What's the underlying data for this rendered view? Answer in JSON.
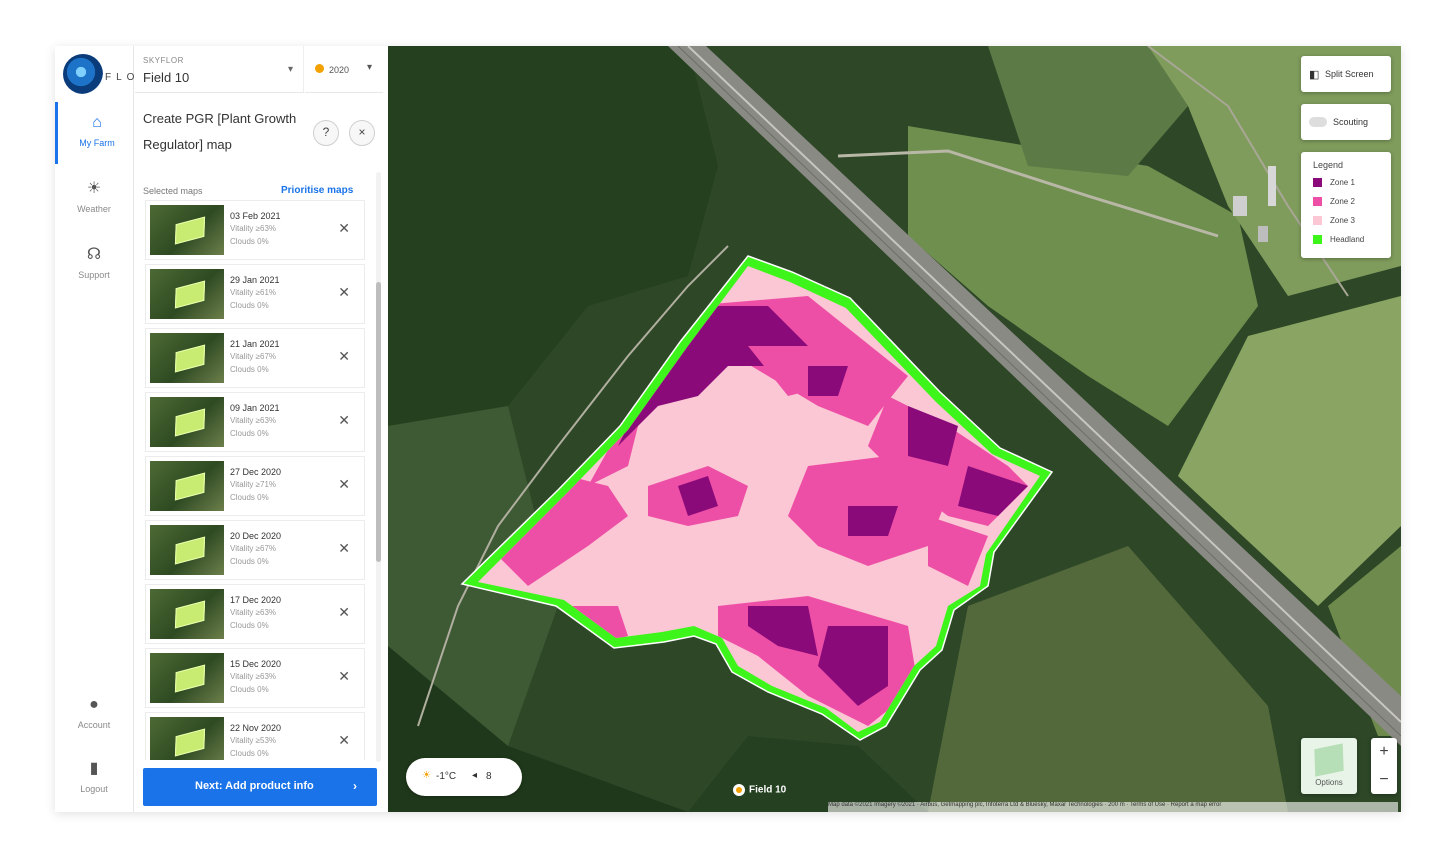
{
  "brand": {
    "logo_text": "FLO"
  },
  "rail": {
    "items": [
      {
        "label": "My Farm",
        "icon": "home-icon",
        "glyph": "⌂",
        "active": true
      },
      {
        "label": "Weather",
        "icon": "sun-icon",
        "glyph": "☀",
        "active": false
      },
      {
        "label": "Support",
        "icon": "headset-icon",
        "glyph": "☊",
        "active": false
      }
    ],
    "bottom": [
      {
        "label": "Account",
        "icon": "account-icon",
        "glyph": "●"
      },
      {
        "label": "Logout",
        "icon": "logout-icon",
        "glyph": "▮"
      }
    ]
  },
  "header": {
    "farm_caption": "SKYFLOR",
    "field_name": "Field 10",
    "season": "2020",
    "collapse_glyph": "«"
  },
  "panel": {
    "title": "Create PGR [Plant Growth Regulator] map",
    "help_glyph": "?",
    "close_glyph": "×",
    "selected_label": "Selected maps",
    "prioritise_label": "Prioritise maps",
    "next_label": "Next: Add product info",
    "next_arrow": "›"
  },
  "maps": [
    {
      "date": "03 Feb 2021",
      "vitality": "Vitality ≥63%",
      "clouds": "Clouds 0%"
    },
    {
      "date": "29 Jan 2021",
      "vitality": "Vitality ≥61%",
      "clouds": "Clouds 0%"
    },
    {
      "date": "21 Jan 2021",
      "vitality": "Vitality ≥67%",
      "clouds": "Clouds 0%"
    },
    {
      "date": "09 Jan 2021",
      "vitality": "Vitality ≥63%",
      "clouds": "Clouds 0%"
    },
    {
      "date": "27 Dec 2020",
      "vitality": "Vitality ≥71%",
      "clouds": "Clouds 0%"
    },
    {
      "date": "20 Dec 2020",
      "vitality": "Vitality ≥67%",
      "clouds": "Clouds 0%"
    },
    {
      "date": "17 Dec 2020",
      "vitality": "Vitality ≥63%",
      "clouds": "Clouds 0%"
    },
    {
      "date": "15 Dec 2020",
      "vitality": "Vitality ≥63%",
      "clouds": "Clouds 0%"
    },
    {
      "date": "22 Nov 2020",
      "vitality": "Vitality ≥53%",
      "clouds": "Clouds 0%"
    }
  ],
  "map": {
    "split_label": "Split Screen",
    "scouting_label": "Scouting",
    "legend_title": "Legend",
    "legend": [
      {
        "label": "Zone 1",
        "color": "#8b0a7a"
      },
      {
        "label": "Zone 2",
        "color": "#ee4fa6"
      },
      {
        "label": "Zone 3",
        "color": "#fbc7d4"
      },
      {
        "label": "Headland",
        "color": "#3df51a"
      }
    ],
    "temp_label": "-1°C",
    "wind_label": "8",
    "field_label": "Field 10",
    "options_label": "Options",
    "zoom_in": "+",
    "zoom_out": "−",
    "attribution": "Map data ©2021 Imagery ©2021 · Airbus, Getmapping plc, Infoterra Ltd & Bluesky, Maxar Technologies · 200 m · Terms of Use · Report a map error"
  }
}
